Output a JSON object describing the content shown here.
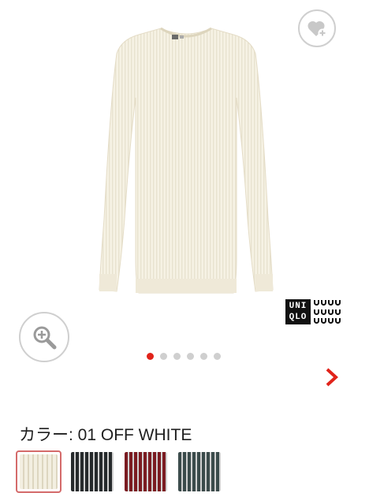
{
  "product": {
    "image_alt": "ribbed crew neck sweater",
    "color_label": "カラー: 01 OFF WHITE"
  },
  "brand": {
    "logo_text_top": "UNI",
    "logo_text_bottom": "QLO"
  },
  "icons": {
    "favorite": "heart-plus-icon",
    "zoom": "magnifier-plus-icon",
    "next": "chevron-right-icon"
  },
  "gallery": {
    "image_count": 6,
    "active_index": 0
  },
  "colors": {
    "accent": "#e1231a",
    "swatches": [
      {
        "name": "off-white",
        "hex": "#f3efe1",
        "selected": true
      },
      {
        "name": "black",
        "hex": "#262a2c",
        "selected": false
      },
      {
        "name": "dark-red",
        "hex": "#7b1c22",
        "selected": false
      },
      {
        "name": "dark-green",
        "hex": "#3b4b4b",
        "selected": false
      }
    ]
  }
}
